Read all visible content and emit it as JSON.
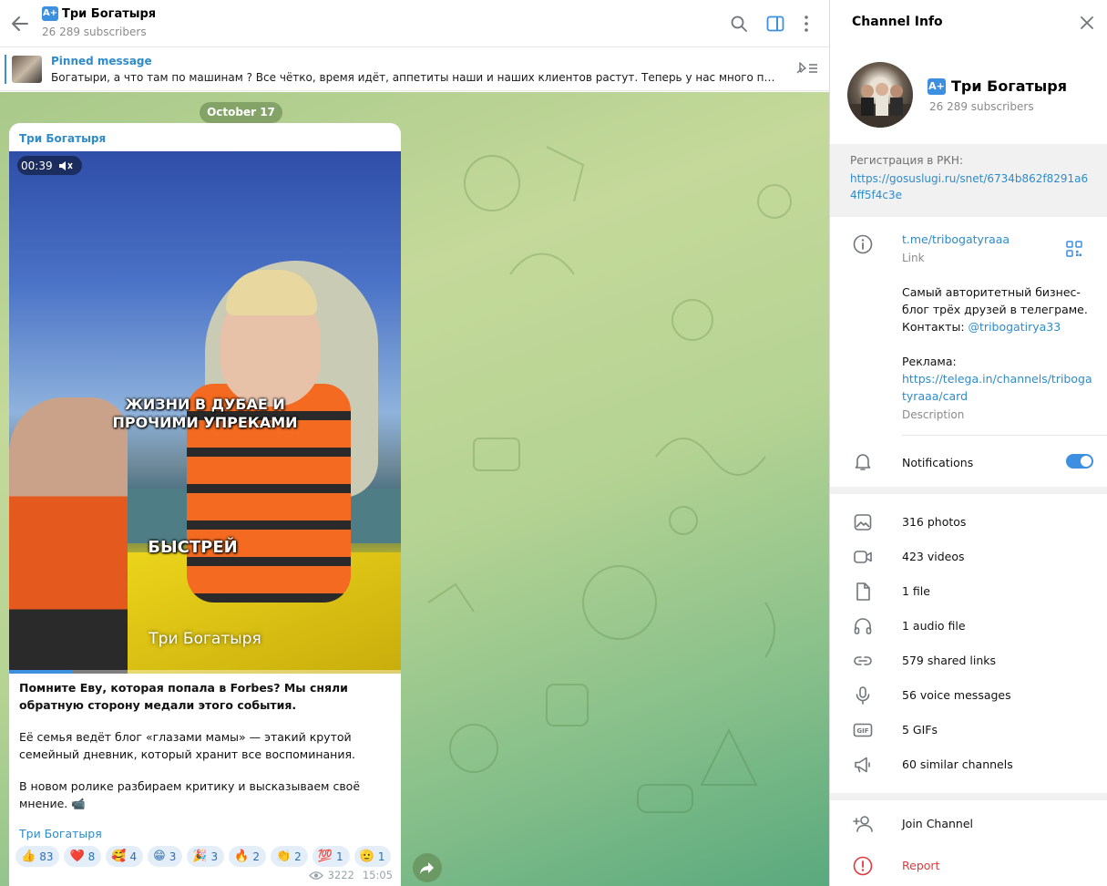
{
  "header": {
    "title": "Три Богатыря",
    "badge": "A+",
    "subscribers": "26 289 subscribers"
  },
  "pinned": {
    "title": "Pinned message",
    "text": "Богатыри, а что там по машинам ?   Все чётко, время идёт, аппетиты наши и наших клиентов растут. Теперь у нас много пре..."
  },
  "date_pill": "October 17",
  "message": {
    "author": "Три Богатыря",
    "video": {
      "time": "00:39",
      "caption_top": "ЖИЗНИ В ДУБАЕ И ПРОЧИМИ УПРЕКАМИ",
      "caption_mid": "БЫСТРЕЙ",
      "watermark": "Три Богатыря",
      "progress": 0.16
    },
    "text_bold": "Помните Еву, которая попала в Forbes? Мы сняли обратную сторону медали этого события.",
    "text_p2": "Её семья ведёт блог «глазами мамы» — этакий крутой семейный дневник, который хранит все воспоминания.",
    "text_p3": "В новом ролике разбираем критику и высказываем своё мнение. 📹",
    "signature": "Три Богатыря",
    "reactions": [
      {
        "emoji": "👍",
        "count": "83"
      },
      {
        "emoji": "❤️",
        "count": "8"
      },
      {
        "emoji": "🥰",
        "count": "4"
      },
      {
        "emoji": "😁",
        "count": "3"
      },
      {
        "emoji": "🎉",
        "count": "3"
      },
      {
        "emoji": "🔥",
        "count": "2"
      },
      {
        "emoji": "👏",
        "count": "2"
      },
      {
        "emoji": "💯",
        "count": "1"
      },
      {
        "emoji": "🫡",
        "count": "1"
      }
    ],
    "views": "3222",
    "time": "15:05"
  },
  "info": {
    "title": "Channel Info",
    "name": "Три Богатыря",
    "subscribers": "26 289 subscribers",
    "rkn_title": "Регистрация в РКН:",
    "rkn_link": "https://gosuslugi.ru/snet/6734b862f8291a64ff5f4c3e",
    "link": "t.me/tribogatyraaa",
    "link_label": "Link",
    "desc_line1": "Самый авторитетный бизнес-блог трёх друзей в телеграме.",
    "desc_contacts": "Контакты: ",
    "desc_contact_handle": "@tribogatirya33",
    "desc_ads": "Реклама:",
    "desc_ads_link": "https://telega.in/channels/tribogatyraaa/card",
    "desc_label": "Description",
    "notifications": "Notifications",
    "notifications_on": true,
    "media": [
      {
        "icon": "photo-icon",
        "label": "316 photos"
      },
      {
        "icon": "video-icon",
        "label": "423 videos"
      },
      {
        "icon": "file-icon",
        "label": "1 file"
      },
      {
        "icon": "headphones-icon",
        "label": "1 audio file"
      },
      {
        "icon": "link-icon",
        "label": "579 shared links"
      },
      {
        "icon": "microphone-icon",
        "label": "56 voice messages"
      },
      {
        "icon": "gif-icon",
        "label": "5 GIFs"
      },
      {
        "icon": "megaphone-icon",
        "label": "60 similar channels"
      }
    ],
    "join": "Join Channel",
    "report": "Report"
  },
  "colors": {
    "accent": "#3d8fe0",
    "link": "#2f8bc9",
    "danger": "#e0393e"
  }
}
